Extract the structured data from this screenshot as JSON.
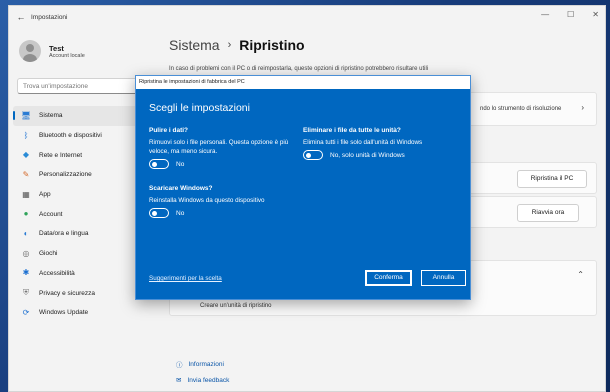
{
  "window": {
    "title": "Impostazioni",
    "back_icon": "←",
    "minimize": "—",
    "maximize": "☐",
    "close": "✕"
  },
  "user": {
    "name": "Test",
    "account": "Account locale"
  },
  "search": {
    "placeholder": "Trova un'impostazione"
  },
  "sidebar": {
    "items": [
      {
        "label": "Sistema",
        "icon": "monitor-icon",
        "glyph": "🖥"
      },
      {
        "label": "Bluetooth e dispositivi",
        "icon": "bluetooth-icon",
        "glyph": "ᛒ"
      },
      {
        "label": "Rete e Internet",
        "icon": "network-icon",
        "glyph": "◆"
      },
      {
        "label": "Personalizzazione",
        "icon": "brush-icon",
        "glyph": "✎"
      },
      {
        "label": "App",
        "icon": "apps-icon",
        "glyph": "▦"
      },
      {
        "label": "Account",
        "icon": "account-icon",
        "glyph": "●"
      },
      {
        "label": "Data/ora e lingua",
        "icon": "globe-icon",
        "glyph": "◐"
      },
      {
        "label": "Giochi",
        "icon": "games-icon",
        "glyph": "◎"
      },
      {
        "label": "Accessibilità",
        "icon": "accessibility-icon",
        "glyph": "✱"
      },
      {
        "label": "Privacy e sicurezza",
        "icon": "shield-icon",
        "glyph": "⛨"
      },
      {
        "label": "Windows Update",
        "icon": "update-icon",
        "glyph": "⟳"
      }
    ]
  },
  "main": {
    "breadcrumb_parent": "Sistema",
    "breadcrumb_sep": "›",
    "breadcrumb_current": "Ripristino",
    "description": "In caso di problemi con il PC o di reimpostarla, queste opzioni di ripristino potrebbero risultare utili",
    "troubleshoot_text": "ndo lo strumento di risoluzione",
    "reset_button": "Ripristina il PC",
    "restart_button": "Riavvia ora",
    "recovery_drive": "Creare un'unità di ripristino",
    "chevron_right": "›",
    "chevron_up": "⌃"
  },
  "links": [
    {
      "label": "Informazioni",
      "icon": "info-icon",
      "glyph": "ⓘ"
    },
    {
      "label": "Invia feedback",
      "icon": "feedback-icon",
      "glyph": "✉"
    }
  ],
  "dialog": {
    "title": "Ripristina le impostazioni di fabbrica del PC",
    "heading": "Scegli le impostazioni",
    "clean_data": {
      "question": "Pulire i dati?",
      "description": "Rimuovi solo i file personali. Questa opzione è più veloce, ma meno sicura.",
      "toggle_label": "No"
    },
    "delete_files": {
      "question": "Eliminare i file da tutte le unità?",
      "description": "Elimina tutti i file solo dall'unità di Windows",
      "toggle_label": "No, solo unità di Windows"
    },
    "download": {
      "question": "Scaricare Windows?",
      "description": "Reinstalla Windows da questo dispositivo",
      "toggle_label": "No"
    },
    "suggestions_link": "Suggerimenti per la scelta",
    "confirm_button": "Conferma",
    "cancel_button": "Annulla"
  }
}
